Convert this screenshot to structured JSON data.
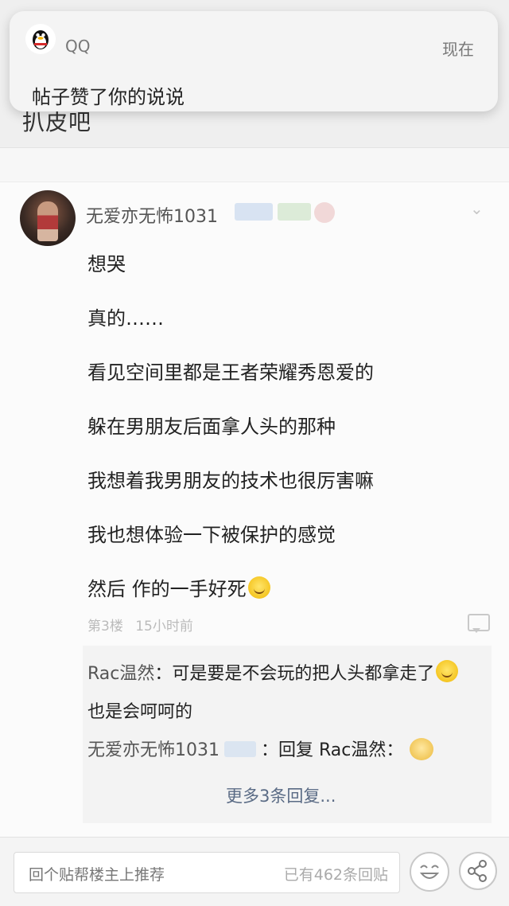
{
  "notification": {
    "app_name": "QQ",
    "time": "现在",
    "message": "帖子赞了你的说说"
  },
  "forum": {
    "title": "扒皮吧"
  },
  "post": {
    "author": "无爱亦无怖1031",
    "lines": [
      "想哭",
      "真的……",
      "看见空间里都是王者荣耀秀恩爱的",
      "躲在男朋友后面拿人头的那种",
      "我想着我男朋友的技术也很厉害嘛",
      "我也想体验一下被保护的感觉",
      "然后 作的一手好死"
    ],
    "floor": "第3楼",
    "time_ago": "15小时前"
  },
  "replies": [
    {
      "author": "Rac温然",
      "text": "：可是要是不会玩的把人头都拿走了",
      "text2": "也是会呵呵的"
    },
    {
      "author": "无爱亦无怖1031",
      "text": "：回复 Rac温然："
    }
  ],
  "more_replies": "更多3条回复...",
  "bottom_bar": {
    "placeholder": "回个贴帮楼主上推荐",
    "reply_count": "已有462条回贴"
  },
  "colors": {
    "link": "#5a6b85",
    "background": "#fafafa"
  },
  "icons": [
    "qq-penguin-icon",
    "chevron-down-icon",
    "comment-icon",
    "smile-emoji-icon",
    "laugh-emoji-icon",
    "share-icon"
  ]
}
